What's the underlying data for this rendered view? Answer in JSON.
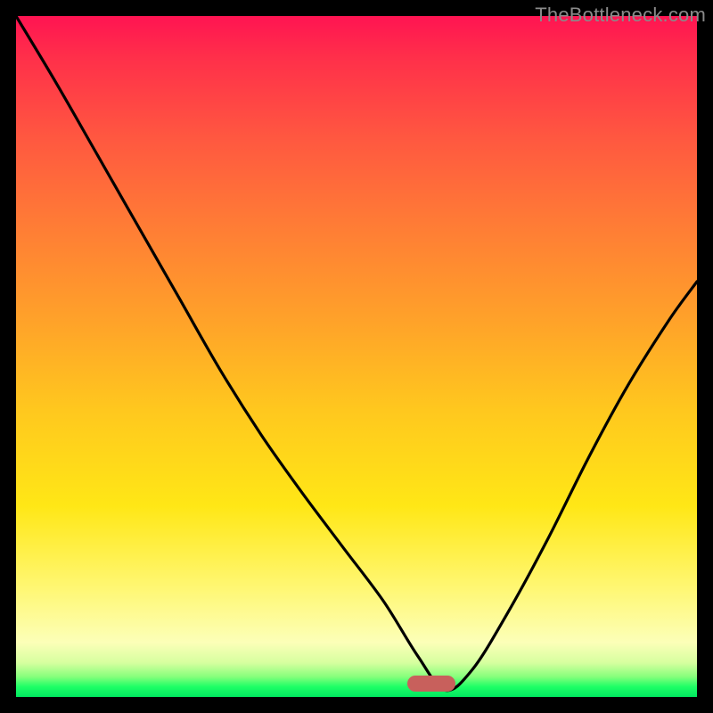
{
  "watermark": "TheBottleneck.com",
  "marker": {
    "x_frac": 0.61,
    "y_frac": 0.98
  },
  "chart_data": {
    "type": "line",
    "title": "",
    "xlabel": "",
    "ylabel": "",
    "xlim": [
      0,
      1
    ],
    "ylim": [
      0,
      1
    ],
    "series": [
      {
        "name": "bottleneck-curve",
        "x": [
          0.0,
          0.06,
          0.12,
          0.18,
          0.24,
          0.3,
          0.36,
          0.42,
          0.48,
          0.54,
          0.59,
          0.63,
          0.67,
          0.72,
          0.78,
          0.84,
          0.9,
          0.96,
          1.0
        ],
        "y": [
          1.0,
          0.9,
          0.795,
          0.69,
          0.585,
          0.48,
          0.385,
          0.3,
          0.22,
          0.14,
          0.06,
          0.01,
          0.04,
          0.12,
          0.23,
          0.35,
          0.46,
          0.555,
          0.61
        ]
      }
    ],
    "annotations": [
      {
        "name": "optimal-marker",
        "x": 0.61,
        "y": 0.01
      }
    ]
  }
}
